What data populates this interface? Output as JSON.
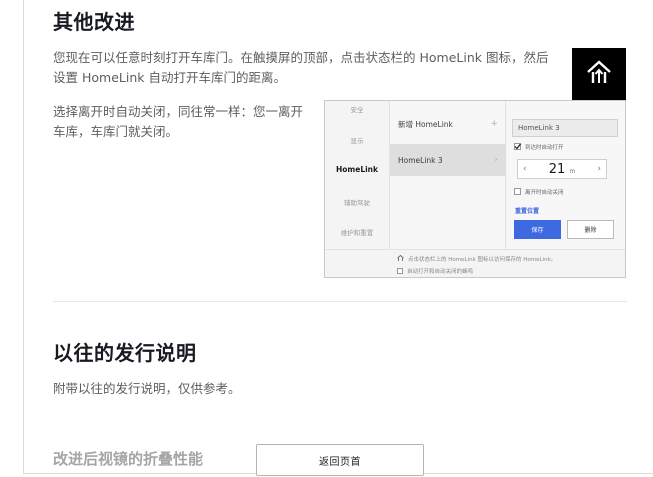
{
  "section1": {
    "title": "其他改进",
    "paragraph1": "您现在可以任意时刻打开车库门。在触摸屏的顶部，点击状态栏的 HomeLink 图标，然后设置 HomeLink 自动打开车库门的距离。",
    "paragraph2": "选择离开时自动关闭，同往常一样：您一离开车库，车库门就关闭。",
    "home_icon": "homelink-icon"
  },
  "panel": {
    "nav": [
      "安全",
      "显示",
      "HomeLink",
      "辅助驾驶",
      "维护和重置"
    ],
    "list": [
      {
        "label": "新增 HomeLink",
        "suffix": "+"
      },
      {
        "label": "HomeLink 3",
        "suffix": "›"
      }
    ],
    "field_value": "HomeLink 3",
    "auto_open_label": "到达时自动打开",
    "stepper_value": "21",
    "stepper_unit": "m",
    "auto_close_label": "离开时自动关闭",
    "reset_label": "重置位置",
    "save_label": "保存",
    "delete_label": "删除",
    "footer_line1": "点击状态栏上的 HomeLink 图标以访问保存的 HomeLink。",
    "footer_line2": "自动打开和自动关闭的蜂鸣"
  },
  "section2": {
    "title": "以往的发行说明",
    "paragraph": "附带以往的发行说明，仅供参考。"
  },
  "footer": {
    "subheading": "改进后视镜的折叠性能",
    "back_button": "返回页首"
  }
}
